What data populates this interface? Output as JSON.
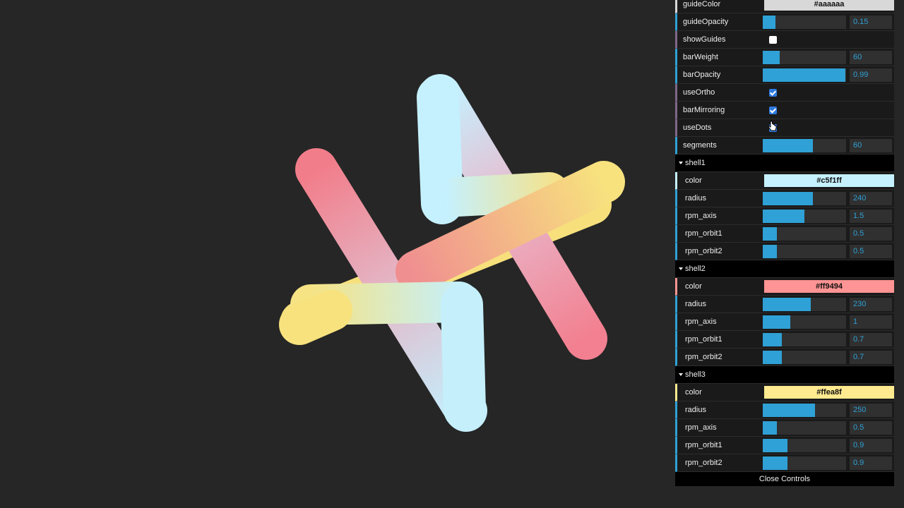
{
  "gui": {
    "top_rows": [
      {
        "label": "guideColor",
        "type": "color",
        "value": "#aaaaaa",
        "color": "#d8d8d8"
      },
      {
        "label": "guideOpacity",
        "type": "slider",
        "value": "0.15",
        "fraction": 0.15
      },
      {
        "label": "showGuides",
        "type": "checkbox",
        "checked": false
      },
      {
        "label": "barWeight",
        "type": "slider",
        "value": "60",
        "fraction": 0.2
      },
      {
        "label": "barOpacity",
        "type": "slider",
        "value": "0.99",
        "fraction": 0.99
      },
      {
        "label": "useOrtho",
        "type": "checkbox",
        "checked": true
      },
      {
        "label": "barMirroring",
        "type": "checkbox",
        "checked": true
      },
      {
        "label": "useDots",
        "type": "checkbox",
        "checked": true
      },
      {
        "label": "segments",
        "type": "slider",
        "value": "60",
        "fraction": 0.6
      }
    ],
    "shells": [
      {
        "title": "shell1",
        "color_value": "#c5f1ff",
        "color": "#c5f1ff",
        "rows": [
          {
            "label": "radius",
            "value": "240",
            "fraction": 0.6
          },
          {
            "label": "rpm_axis",
            "value": "1.5",
            "fraction": 0.5
          },
          {
            "label": "rpm_orbit1",
            "value": "0.5",
            "fraction": 0.17
          },
          {
            "label": "rpm_orbit2",
            "value": "0.5",
            "fraction": 0.17
          }
        ]
      },
      {
        "title": "shell2",
        "color_value": "#ff9494",
        "color": "#ff9494",
        "rows": [
          {
            "label": "radius",
            "value": "230",
            "fraction": 0.58
          },
          {
            "label": "rpm_axis",
            "value": "1",
            "fraction": 0.33
          },
          {
            "label": "rpm_orbit1",
            "value": "0.7",
            "fraction": 0.23
          },
          {
            "label": "rpm_orbit2",
            "value": "0.7",
            "fraction": 0.23
          }
        ]
      },
      {
        "title": "shell3",
        "color_value": "#ffea8f",
        "color": "#ffea8f",
        "rows": [
          {
            "label": "radius",
            "value": "250",
            "fraction": 0.63
          },
          {
            "label": "rpm_axis",
            "value": "0.5",
            "fraction": 0.17
          },
          {
            "label": "rpm_orbit1",
            "value": "0.9",
            "fraction": 0.3
          },
          {
            "label": "rpm_orbit2",
            "value": "0.9",
            "fraction": 0.3
          }
        ]
      }
    ],
    "close_label": "Close Controls"
  },
  "colors": {
    "background": "#262626",
    "accent": "#2fa1d6"
  }
}
